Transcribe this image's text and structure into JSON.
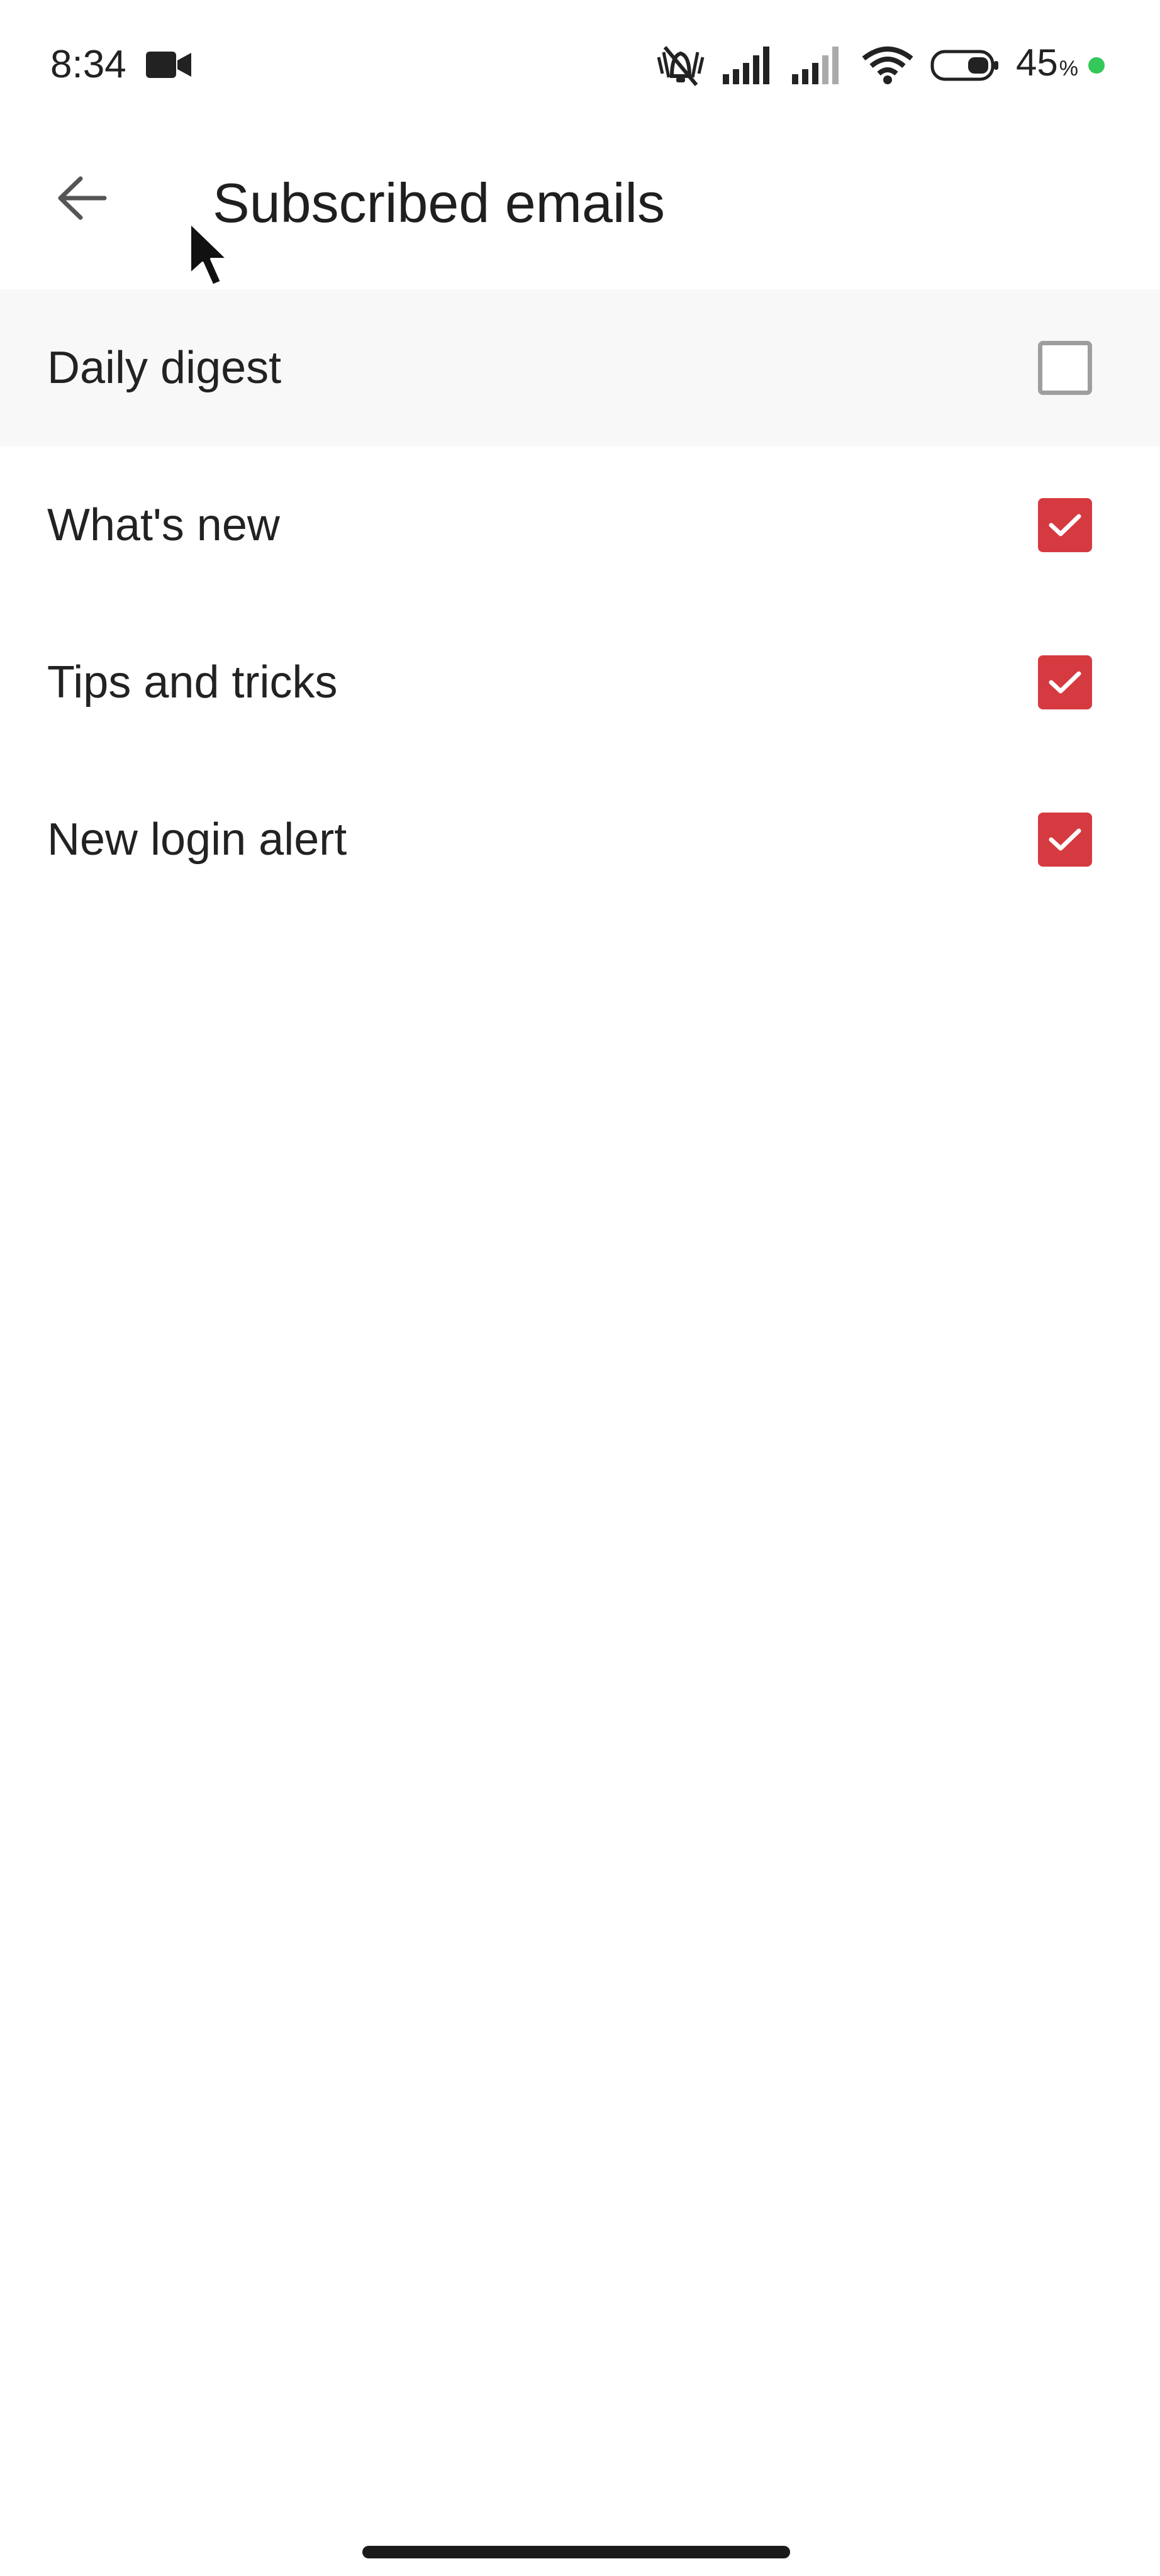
{
  "status_bar": {
    "time": "8:34",
    "battery_percent": "45",
    "battery_percent_sign": "%",
    "icons": [
      "video-camera-icon",
      "mute-vibrate-icon",
      "signal-icon",
      "signal-icon",
      "wifi-icon",
      "battery-icon"
    ],
    "charging_dot_color": "#34c759"
  },
  "header": {
    "back_icon": "arrow-left-icon",
    "title": "Subscribed emails"
  },
  "subscriptions": [
    {
      "label": "Daily digest",
      "checked": false
    },
    {
      "label": "What's new",
      "checked": true
    },
    {
      "label": "Tips and tricks",
      "checked": true
    },
    {
      "label": "New login alert",
      "checked": true
    }
  ],
  "colors": {
    "accent": "#d63a41",
    "highlight_row": "#f8f8f8",
    "unchecked_border": "#9e9e9e"
  }
}
